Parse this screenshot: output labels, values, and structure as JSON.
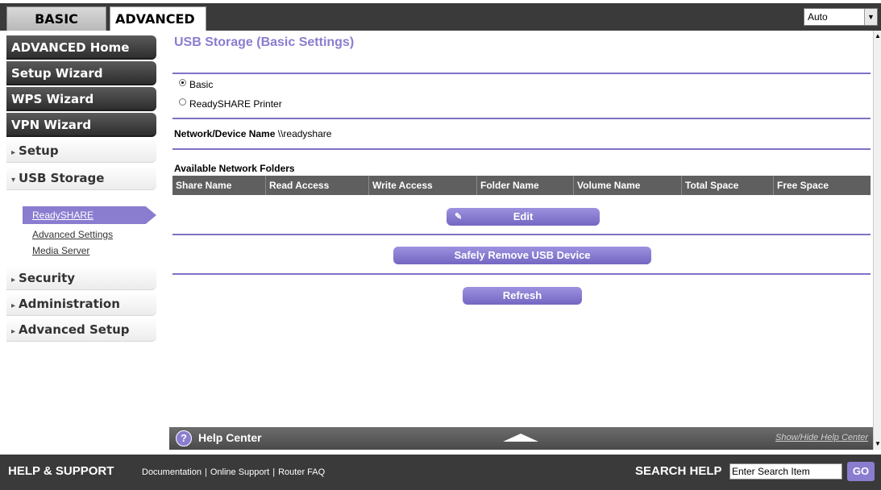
{
  "tabs": {
    "basic": "BASIC",
    "advanced": "ADVANCED"
  },
  "language": {
    "selected": "Auto"
  },
  "sidebar": {
    "advanced_home": "ADVANCED Home",
    "setup_wizard": "Setup Wizard",
    "wps_wizard": "WPS Wizard",
    "vpn_wizard": "VPN Wizard",
    "setup": "Setup",
    "usb_storage": "USB Storage",
    "sub_items": [
      "ReadySHARE",
      "Advanced Settings",
      "Media Server"
    ],
    "security": "Security",
    "administration": "Administration",
    "advanced_setup": "Advanced Setup"
  },
  "main": {
    "title": "USB Storage (Basic Settings)",
    "radio_basic": "Basic",
    "radio_printer": "ReadySHARE Printer",
    "device_name_label": "Network/Device Name",
    "device_name_value": "\\\\readyshare",
    "folders_label": "Available Network Folders",
    "columns": [
      "Share Name",
      "Read Access",
      "Write Access",
      "Folder Name",
      "Volume Name",
      "Total Space",
      "Free Space"
    ],
    "edit": "Edit",
    "safely_remove": "Safely Remove USB Device",
    "refresh": "Refresh"
  },
  "help_center": {
    "title": "Help Center",
    "toggle": "Show/Hide Help Center",
    "icon": "?"
  },
  "footer": {
    "title": "HELP & SUPPORT",
    "links": [
      "Documentation",
      "Online Support",
      "Router FAQ"
    ],
    "search_title": "SEARCH HELP",
    "search_value": "Enter Search Item",
    "go": "GO"
  },
  "colors": {
    "accent": "#8a7dd0",
    "dark": "#3a3a3a"
  }
}
